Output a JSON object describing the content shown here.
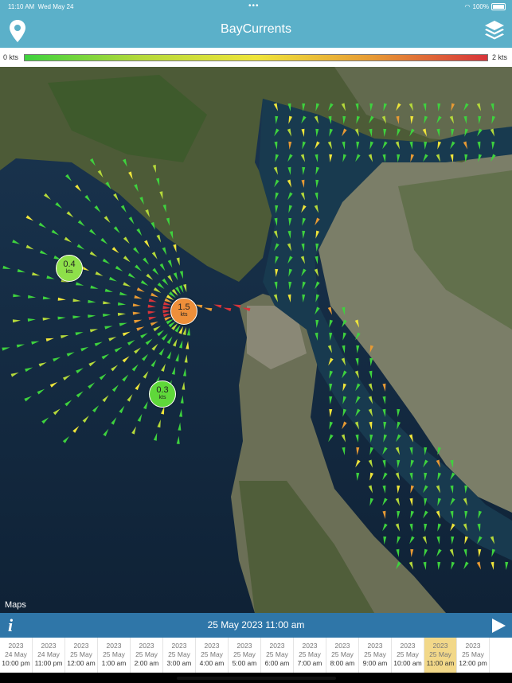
{
  "status": {
    "time": "11:10 AM",
    "date": "Wed May 24",
    "battery": "100%"
  },
  "app": {
    "title": "BayCurrents"
  },
  "legend": {
    "min": "0 kts",
    "max": "2 kts",
    "colors": [
      "#3ed23e",
      "#b5d93a",
      "#efe53a",
      "#e79a34",
      "#d8343a"
    ]
  },
  "map": {
    "attribution": "Maps",
    "bubbles": [
      {
        "value": "0.4",
        "unit": "kts",
        "color": "#8ee04a"
      },
      {
        "value": "1.5",
        "unit": "kts",
        "color": "#ee8f3a"
      },
      {
        "value": "0.3",
        "unit": "kts",
        "color": "#5fd83a"
      }
    ]
  },
  "timeline": {
    "current": "25 May 2023  11:00 am",
    "info_icon": "info-icon",
    "play_icon": "play-icon",
    "slots": [
      {
        "year": "2023",
        "date": "24 May",
        "time": "10:00 pm"
      },
      {
        "year": "2023",
        "date": "24 May",
        "time": "11:00 pm"
      },
      {
        "year": "2023",
        "date": "25 May",
        "time": "12:00 am"
      },
      {
        "year": "2023",
        "date": "25 May",
        "time": "1:00 am"
      },
      {
        "year": "2023",
        "date": "25 May",
        "time": "2:00 am"
      },
      {
        "year": "2023",
        "date": "25 May",
        "time": "3:00 am"
      },
      {
        "year": "2023",
        "date": "25 May",
        "time": "4:00 am"
      },
      {
        "year": "2023",
        "date": "25 May",
        "time": "5:00 am"
      },
      {
        "year": "2023",
        "date": "25 May",
        "time": "6:00 am"
      },
      {
        "year": "2023",
        "date": "25 May",
        "time": "7:00 am"
      },
      {
        "year": "2023",
        "date": "25 May",
        "time": "8:00 am"
      },
      {
        "year": "2023",
        "date": "25 May",
        "time": "9:00 am"
      },
      {
        "year": "2023",
        "date": "25 May",
        "time": "10:00 am"
      },
      {
        "year": "2023",
        "date": "25 May",
        "time": "11:00 am",
        "selected": true
      },
      {
        "year": "2023",
        "date": "25 May",
        "time": "12:00 pm"
      }
    ]
  }
}
